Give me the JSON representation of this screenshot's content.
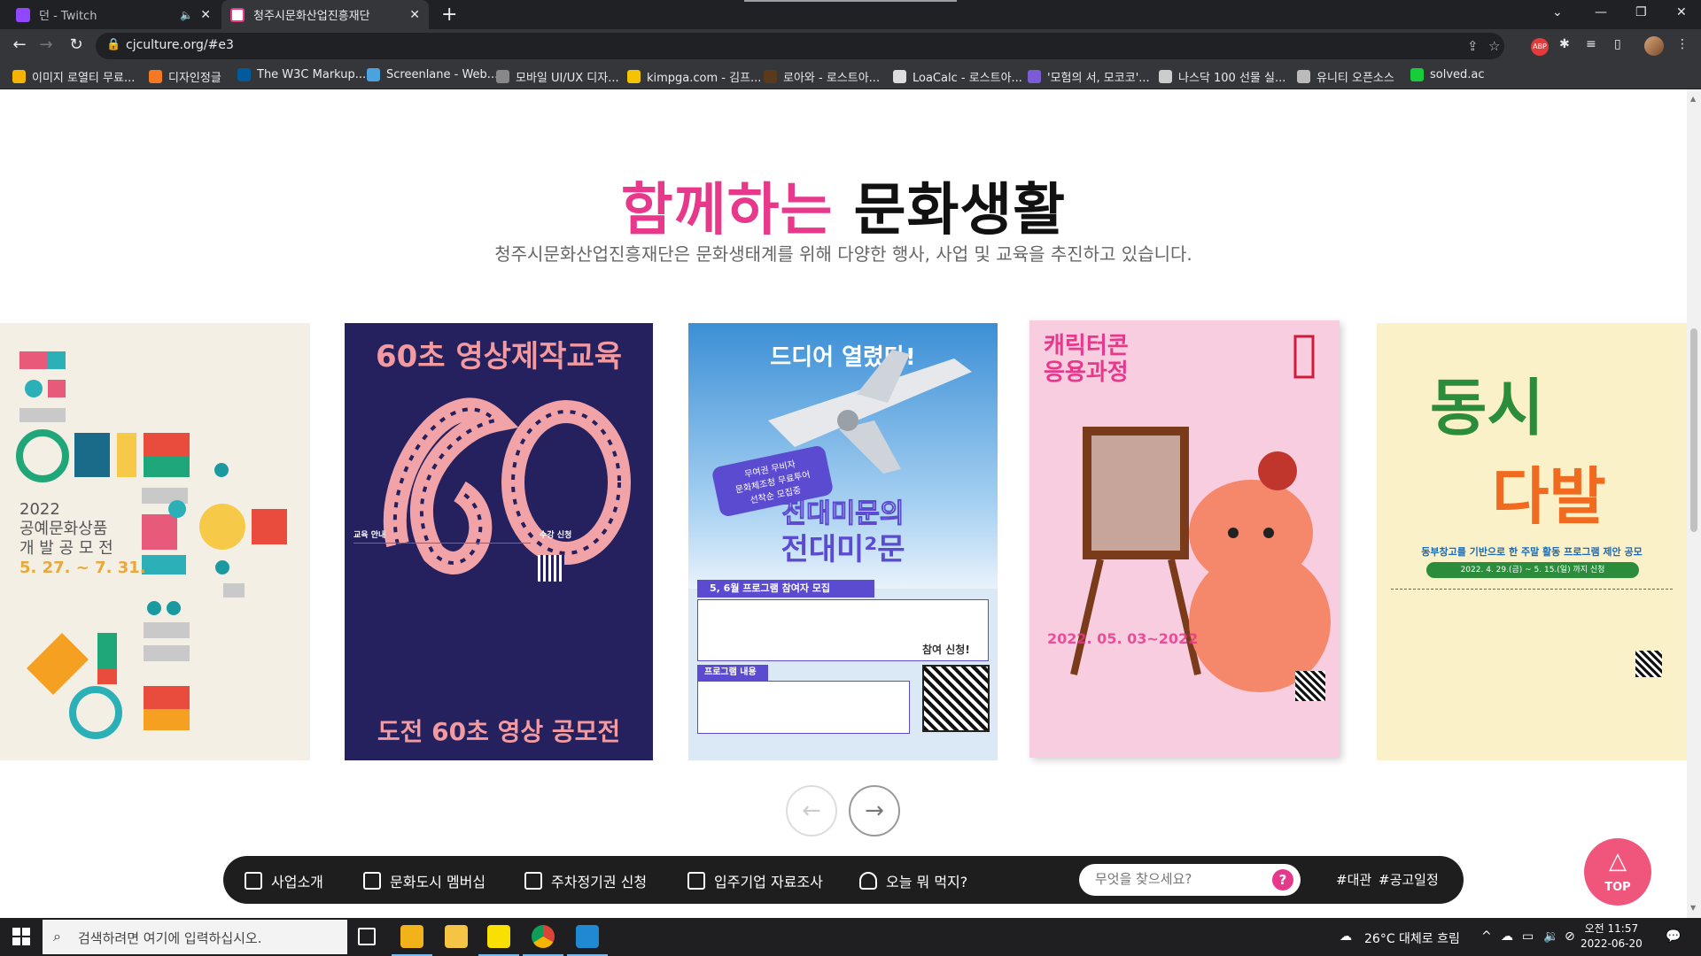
{
  "browser": {
    "tabs": [
      {
        "title": "던    - Twitch",
        "favicon_color": "#9146ff"
      },
      {
        "title": "청주시문화산업진흥재단",
        "favicon_color": "#e8388c"
      }
    ],
    "url": "cjculture.org/#e3",
    "bookmarks": [
      {
        "label": "이미지 로열티 무료...",
        "color": "#f5b400"
      },
      {
        "label": "디자인정글",
        "color": "#f47920"
      },
      {
        "label": "The W3C Markup...",
        "color": "#005a9c"
      },
      {
        "label": "Screenlane - Web...",
        "color": "#4aa3df"
      },
      {
        "label": "모바일 UI/UX 디자...",
        "color": "#888888"
      },
      {
        "label": "kimpga.com - 김프...",
        "color": "#f5c400"
      },
      {
        "label": "로아와 - 로스트아...",
        "color": "#5a3a1a"
      },
      {
        "label": "LoaCalc - 로스트아...",
        "color": "#dddddd"
      },
      {
        "label": "'모험의 서, 모코코'...",
        "color": "#7b5cd6"
      },
      {
        "label": "나스닥 100 선물 실...",
        "color": "#cccccc"
      },
      {
        "label": "유니티 오픈소스",
        "color": "#bbbbbb"
      },
      {
        "label": "solved.ac",
        "color": "#17ce3a"
      }
    ]
  },
  "section": {
    "title_highlight": "함께하는",
    "title_rest": "문화생활",
    "subtitle": "청주시문화산업진흥재단은 문화생태계를 위해 다양한 행사, 사업 및 교육을 추진하고 있습니다."
  },
  "posters": {
    "p1": {
      "year": "2022",
      "line1": "공예문화상품",
      "line2": "개 발 공 모 전",
      "dates": "5. 27. ~ 7. 31."
    },
    "p2": {
      "title": "60초 영상제작교육",
      "big": "60",
      "footer": "도전 60초 영상 공모전",
      "info1": "교육 안내",
      "info2": "수강 신청"
    },
    "p3": {
      "top": "드디어 열렸다!",
      "bubble1": "무여권 무비자",
      "bubble2": "문화체조청 무료투어",
      "bubble3": "선착순 모집중",
      "line1": "전대미문의",
      "line2": "전대미²문",
      "band": "5, 6월 프로그램 참여자 모집",
      "band2": "프로그램 내용",
      "qr_label": "참여 신청!"
    },
    "p4": {
      "title1": "캐릭터콘",
      "title2": "응용과정",
      "year": "2022. 05. 03~2022"
    },
    "p5": {
      "title1": "동시",
      "title2": "다발",
      "sub": "동부창고를 기반으로 한 주말 활동 프로그램 제안 공모",
      "dates": "2022. 4. 29.(금) ~ 5. 15.(일) 까지 신청"
    }
  },
  "carousel": {
    "prev": "←",
    "next": "→"
  },
  "quickbar": {
    "items": [
      {
        "label": "사업소개"
      },
      {
        "label": "문화도시 멤버십"
      },
      {
        "label": "주차정기권 신청"
      },
      {
        "label": "입주기업 자료조사"
      },
      {
        "label": "오늘 뭐 먹지?"
      }
    ],
    "search_placeholder": "무엇을 찾으세요?",
    "help": "?",
    "tags": [
      "#대관",
      "#공고일정"
    ]
  },
  "top_button": {
    "label": "TOP"
  },
  "taskbar": {
    "search_placeholder": "검색하려면 여기에 입력하십시오.",
    "weather": "26°C  대체로 흐림",
    "time": "오전 11:57",
    "date": "2022-06-20"
  }
}
